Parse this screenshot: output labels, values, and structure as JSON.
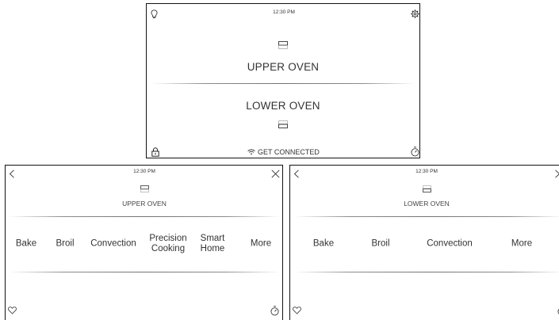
{
  "main_screen": {
    "time": "12:30 PM",
    "upper_label": "UPPER OVEN",
    "lower_label": "LOWER OVEN",
    "connect_label": "GET CONNECTED",
    "icons": [
      "lightbulb-icon",
      "gear-icon",
      "upper-oven-icon",
      "lower-oven-icon",
      "lock-icon",
      "wifi-icon",
      "timer-icon"
    ]
  },
  "upper_screen": {
    "time": "12:30 PM",
    "title": "UPPER OVEN",
    "menu": [
      {
        "label": "Bake"
      },
      {
        "label": "Broil"
      },
      {
        "label": "Convection"
      },
      {
        "label": "Precision\nCooking"
      },
      {
        "label": "Smart\nHome"
      },
      {
        "label": "More"
      }
    ],
    "icons": [
      "back-arrow-icon",
      "close-icon",
      "upper-oven-icon",
      "heart-icon",
      "timer-icon"
    ]
  },
  "lower_screen": {
    "time": "12:30 PM",
    "title": "LOWER OVEN",
    "menu": [
      {
        "label": "Bake"
      },
      {
        "label": "Broil"
      },
      {
        "label": "Convection"
      },
      {
        "label": "More"
      }
    ],
    "icons": [
      "back-arrow-icon",
      "forward-arrow-icon",
      "lower-oven-icon",
      "heart-icon",
      "timer-icon"
    ]
  }
}
